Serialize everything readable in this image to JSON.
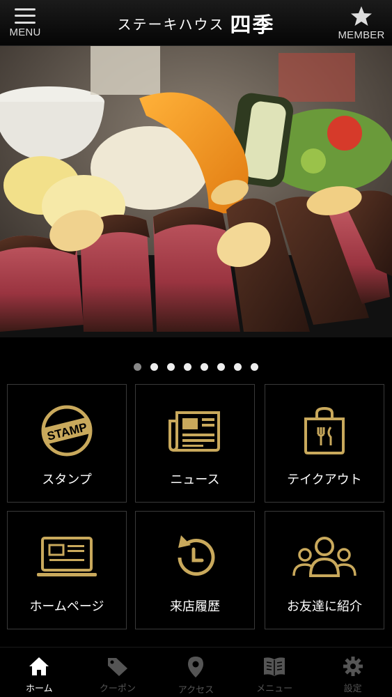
{
  "header": {
    "menu_label": "MENU",
    "title_text": "ステーキハウス",
    "title_brand": "四季",
    "member_label": "MEMBER"
  },
  "carousel": {
    "page_count": 8,
    "active_index": 0
  },
  "tiles": [
    {
      "label": "スタンプ",
      "icon": "stamp-icon",
      "stamp_text": "STAMP"
    },
    {
      "label": "ニュース",
      "icon": "newspaper-icon"
    },
    {
      "label": "テイクアウト",
      "icon": "takeout-bag-icon"
    },
    {
      "label": "ホームページ",
      "icon": "laptop-icon"
    },
    {
      "label": "来店履歴",
      "icon": "history-icon"
    },
    {
      "label": "お友達に紹介",
      "icon": "friends-icon"
    }
  ],
  "nav": [
    {
      "label": "ホーム",
      "icon": "home-icon",
      "active": true
    },
    {
      "label": "クーポン",
      "icon": "coupon-tag-icon",
      "active": false
    },
    {
      "label": "アクセス",
      "icon": "map-pin-icon",
      "active": false
    },
    {
      "label": "メニュー",
      "icon": "menu-book-icon",
      "active": false
    },
    {
      "label": "設定",
      "icon": "gear-icon",
      "active": false
    }
  ],
  "colors": {
    "gold": "#c9a95c",
    "nav_inactive": "#555555",
    "background": "#000000"
  }
}
